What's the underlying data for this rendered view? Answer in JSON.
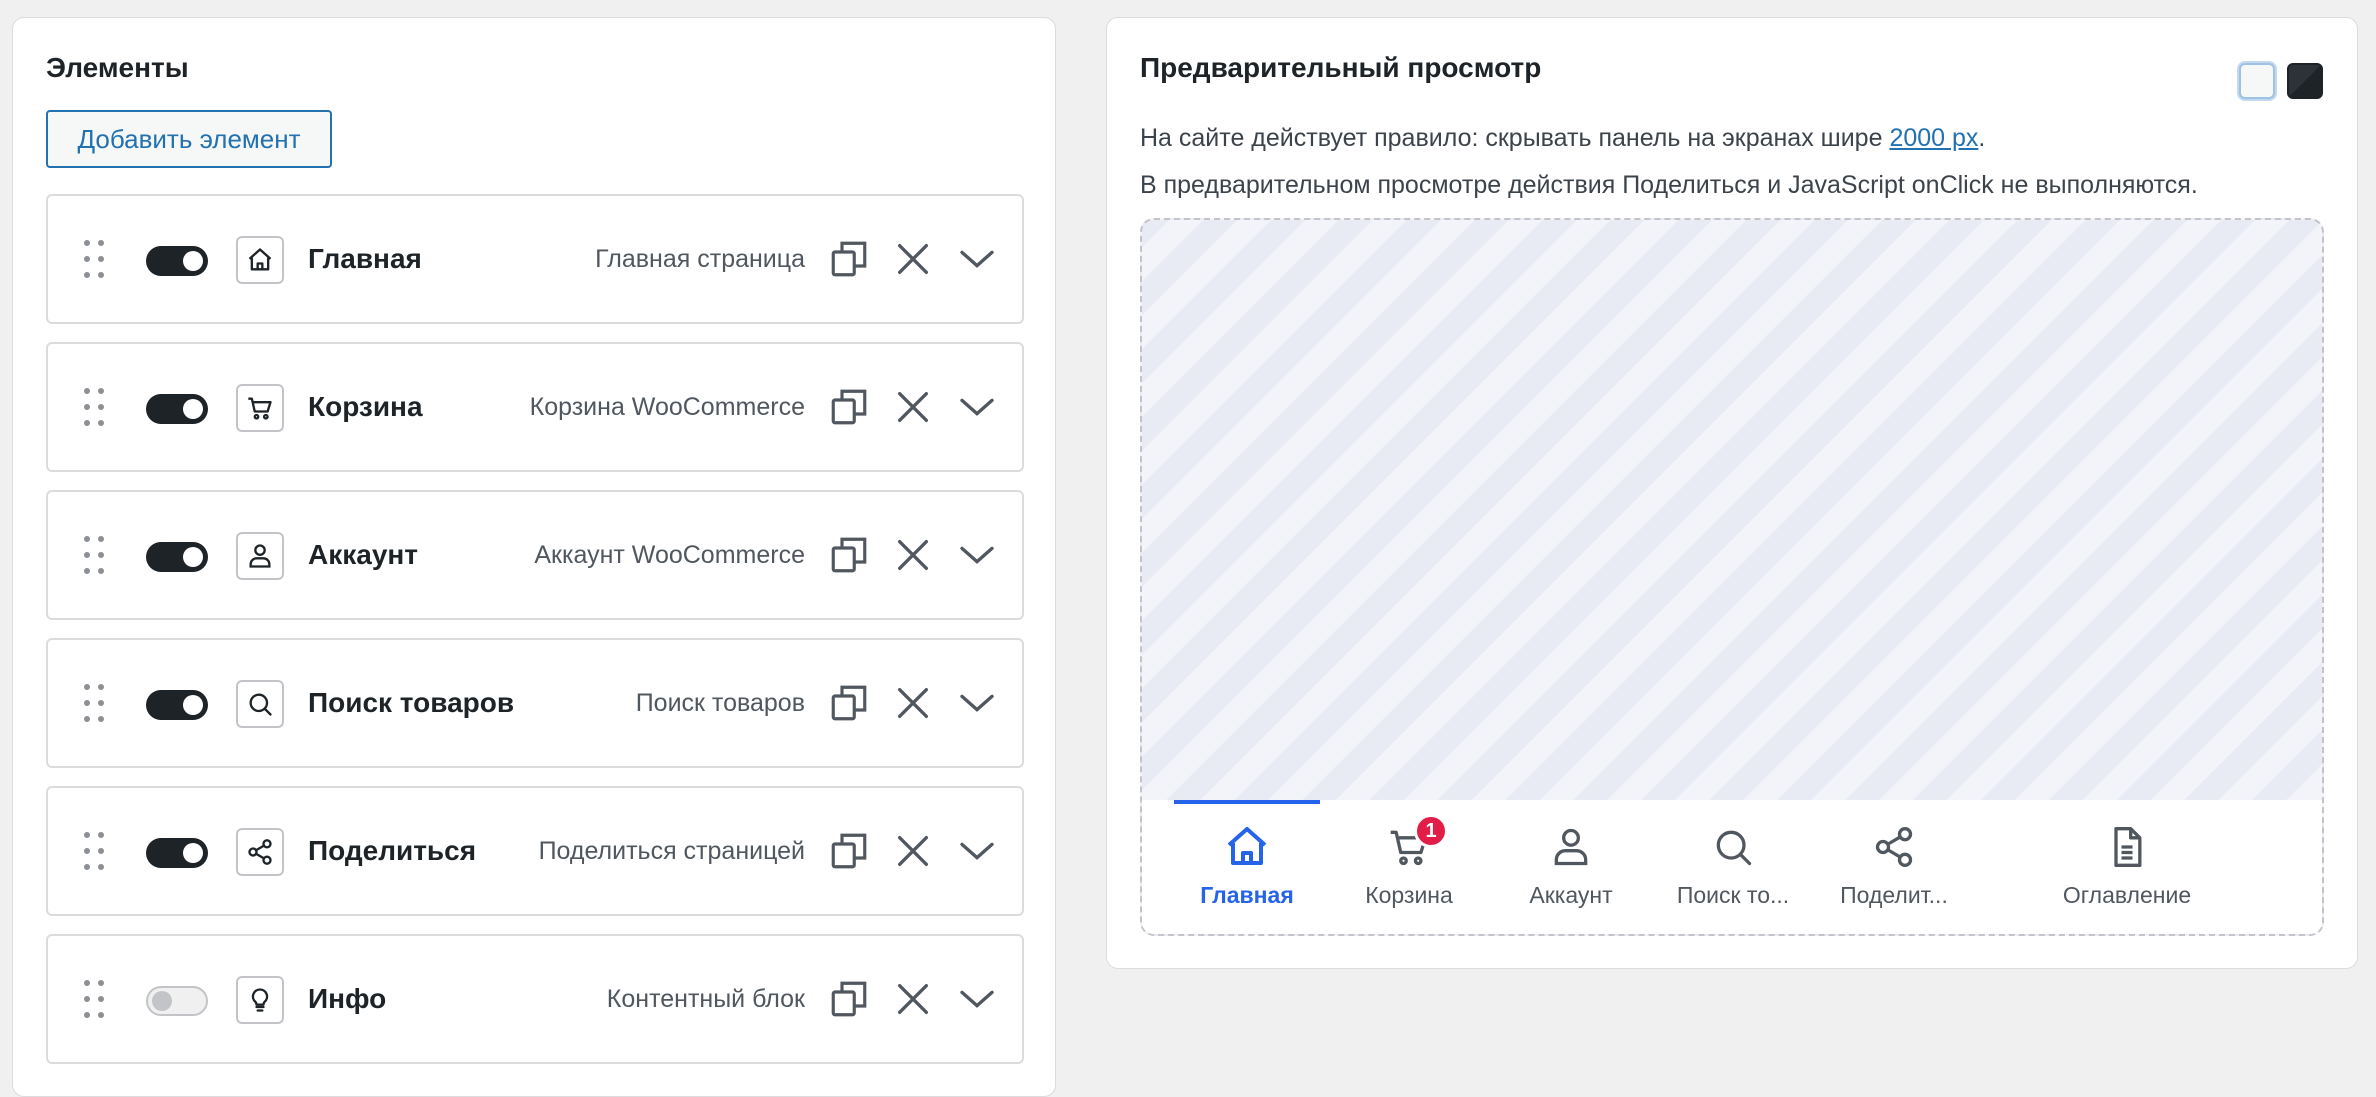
{
  "elements_panel": {
    "title": "Элементы",
    "add_button": "Добавить элемент",
    "rows": [
      {
        "label": "Главная",
        "type": "Главная страница",
        "icon": "home-icon",
        "enabled": true
      },
      {
        "label": "Корзина",
        "type": "Корзина WooCommerce",
        "icon": "cart-icon",
        "enabled": true
      },
      {
        "label": "Аккаунт",
        "type": "Аккаунт WooCommerce",
        "icon": "user-icon",
        "enabled": true
      },
      {
        "label": "Поиск товаров",
        "type": "Поиск товаров",
        "icon": "search-icon",
        "enabled": true
      },
      {
        "label": "Поделиться",
        "type": "Поделиться страницей",
        "icon": "share-icon",
        "enabled": true
      },
      {
        "label": "Инфо",
        "type": "Контентный блок",
        "icon": "lightbulb-icon",
        "enabled": false
      }
    ]
  },
  "preview_panel": {
    "title": "Предварительный просмотр",
    "notice1_prefix": "На сайте действует правило: скрывать панель на экранах шире ",
    "notice1_link": "2000 px",
    "notice1_suffix": ".",
    "notice2": "В предварительном просмотре действия Поделиться и JavaScript onClick не выполняются.",
    "theme_options": [
      "light-theme-swatch",
      "dark-theme-swatch"
    ],
    "tabs": [
      {
        "label": "Главная",
        "icon": "home-icon",
        "active": true
      },
      {
        "label": "Корзина",
        "icon": "cart-icon",
        "badge": "1"
      },
      {
        "label": "Аккаунт",
        "icon": "user-icon"
      },
      {
        "label": "Поиск то...",
        "icon": "search-icon"
      },
      {
        "label": "Поделит...",
        "icon": "share-icon"
      },
      {
        "label": "Оглавление",
        "icon": "document-icon"
      }
    ]
  },
  "colors": {
    "accent": "#2563eb",
    "link": "#2271b1",
    "badge": "#e11d48",
    "toggle_on": "#1d2327"
  }
}
